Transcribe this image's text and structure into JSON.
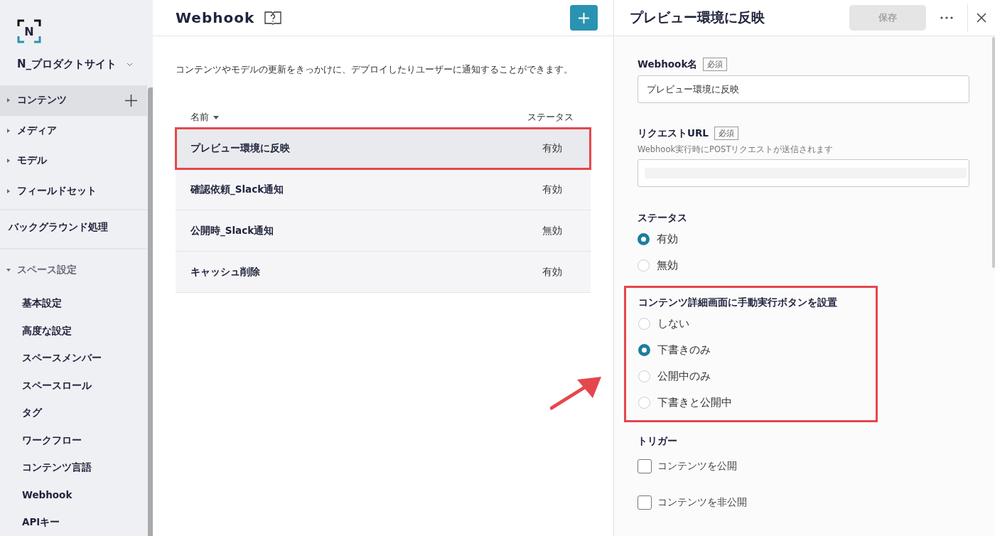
{
  "sidebar": {
    "logo": "N",
    "project": "N_プロダクトサイト",
    "nav_groups": [
      {
        "label": "コンテンツ",
        "expanded": false,
        "selected": true
      },
      {
        "label": "メディア",
        "expanded": false,
        "selected": false
      },
      {
        "label": "モデル",
        "expanded": false,
        "selected": false
      },
      {
        "label": "フィールドセット",
        "expanded": false,
        "selected": false
      }
    ],
    "background_item": {
      "label": "バックグラウンド処理",
      "selected": false
    },
    "settings": {
      "label": "スペース設定",
      "expanded": true,
      "children": [
        {
          "label": "基本設定",
          "selected": false
        },
        {
          "label": "高度な設定",
          "selected": false
        },
        {
          "label": "スペースメンバー",
          "selected": false
        },
        {
          "label": "スペースロール",
          "selected": false
        },
        {
          "label": "タグ",
          "selected": false
        },
        {
          "label": "ワークフロー",
          "selected": false
        },
        {
          "label": "コンテンツ言語",
          "selected": false
        },
        {
          "label": "Webhook",
          "selected": false
        },
        {
          "label": "APIキー",
          "selected": false
        }
      ]
    }
  },
  "main": {
    "title": "Webhook",
    "description": "コンテンツやモデルの更新をきっかけに、デプロイしたりユーザーに通知することができます。",
    "columns": [
      "名前",
      "ステータス"
    ],
    "rows": [
      {
        "name": "プレビュー環境に反映",
        "status": "有効",
        "selected": true
      },
      {
        "name": "確認依頼_Slack通知",
        "status": "有効",
        "selected": false
      },
      {
        "name": "公開時_Slack通知",
        "status": "無効",
        "selected": false
      },
      {
        "name": "キャッシュ削除",
        "status": "有効",
        "selected": false
      }
    ]
  },
  "panel": {
    "title": "プレビュー環境に反映",
    "save_button": {
      "label": "保存",
      "disabled": true
    },
    "name_field": {
      "label": "Webhook名",
      "badge": "必須",
      "value": "プレビュー環境に反映"
    },
    "url_field": {
      "label": "リクエストURL",
      "badge": "必須",
      "hint": "Webhook実行時にPOSTリクエストが送信されます"
    },
    "radio_groups": [
      {
        "label": "ステータス",
        "highlighted": false,
        "options": [
          {
            "label": "有効",
            "selected": true
          },
          {
            "label": "無効",
            "selected": false
          }
        ]
      },
      {
        "label": "コンテンツ詳細画面に手動実行ボタンを設置",
        "highlighted": true,
        "options": [
          {
            "label": "しない",
            "selected": false
          },
          {
            "label": "下書きのみ",
            "selected": true
          },
          {
            "label": "公開中のみ",
            "selected": false
          },
          {
            "label": "下書きと公開中",
            "selected": false
          }
        ]
      }
    ],
    "triggers": {
      "label": "トリガー",
      "options": [
        {
          "label": "コンテンツを公開",
          "checked": false
        },
        {
          "label": "コンテンツを非公開",
          "checked": false
        }
      ]
    }
  }
}
